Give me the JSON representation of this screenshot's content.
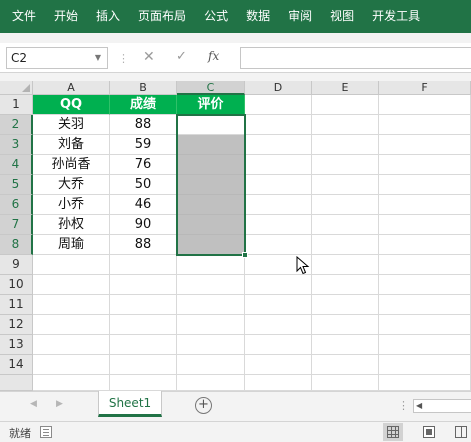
{
  "ribbon": {
    "tabs": [
      "文件",
      "开始",
      "插入",
      "页面布局",
      "公式",
      "数据",
      "审阅",
      "视图",
      "开发工具"
    ]
  },
  "formula_bar": {
    "name_box": "C2",
    "cancel_icon": "cancel-x-icon",
    "enter_icon": "check-icon",
    "fx_label": "fx",
    "formula_value": ""
  },
  "grid": {
    "columns": [
      "A",
      "B",
      "C",
      "D",
      "E",
      "F"
    ],
    "rows": [
      "1",
      "2",
      "3",
      "4",
      "5",
      "6",
      "7",
      "8",
      "9",
      "10",
      "11",
      "12",
      "13",
      "14"
    ],
    "header": [
      "QQ",
      "成绩",
      "评价"
    ],
    "data": [
      {
        "name": "关羽",
        "score": "88",
        "rating": ""
      },
      {
        "name": "刘备",
        "score": "59",
        "rating": ""
      },
      {
        "name": "孙尚香",
        "score": "76",
        "rating": ""
      },
      {
        "name": "大乔",
        "score": "50",
        "rating": ""
      },
      {
        "name": "小乔",
        "score": "46",
        "rating": ""
      },
      {
        "name": "孙权",
        "score": "90",
        "rating": ""
      },
      {
        "name": "周瑜",
        "score": "88",
        "rating": ""
      }
    ],
    "selected_range": "C2:C8",
    "active_cell": "C2"
  },
  "sheet_tabs": {
    "tabs": [
      "Sheet1"
    ],
    "active": "Sheet1",
    "add_icon": "add-sheet-icon"
  },
  "status_bar": {
    "status_text": "就绪"
  },
  "colors": {
    "excel_green": "#217346",
    "header_fill": "#00b050",
    "selection_shade": "#c0c0c0"
  }
}
